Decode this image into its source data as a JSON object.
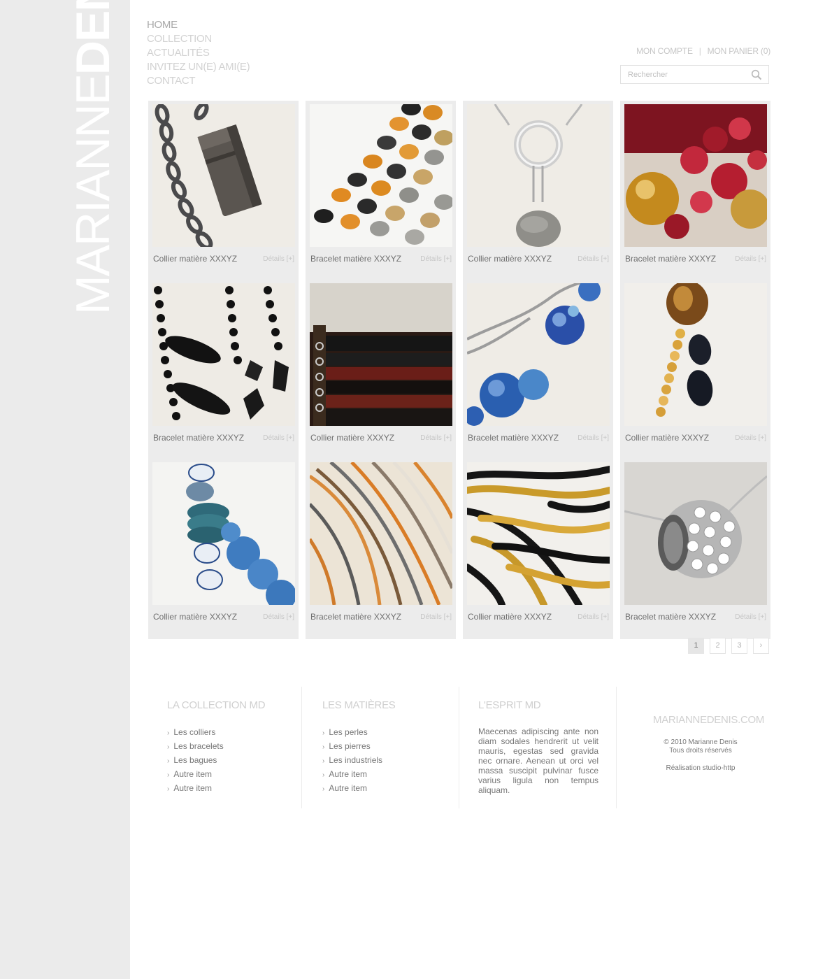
{
  "brand": {
    "part1": "MARIANNE",
    "part2": "DENIS"
  },
  "nav": {
    "items": [
      {
        "label": "HOME",
        "active": true
      },
      {
        "label": "COLLECTION"
      },
      {
        "label": "ACTUALITÉS"
      },
      {
        "label": "INVITEZ UN(E) AMI(E)"
      },
      {
        "label": "CONTACT"
      }
    ]
  },
  "account": {
    "my_account": "MON COMPTE",
    "separator": "|",
    "cart": "MON PANIER (0)"
  },
  "search": {
    "placeholder": "Rechercher",
    "icon": "search-icon"
  },
  "products": [
    {
      "name": "Collier matière XXXYZ",
      "details": "Détails [+]"
    },
    {
      "name": "Bracelet matière XXXYZ",
      "details": "Détails [+]"
    },
    {
      "name": "Collier matière XXXYZ",
      "details": "Détails [+]"
    },
    {
      "name": "Bracelet matière XXXYZ",
      "details": "Détails [+]"
    },
    {
      "name": "Bracelet matière XXXYZ",
      "details": "Détails [+]"
    },
    {
      "name": "Collier matière XXXYZ",
      "details": "Détails [+]"
    },
    {
      "name": "Bracelet matière XXXYZ",
      "details": "Détails [+]"
    },
    {
      "name": "Collier matière XXXYZ",
      "details": "Détails [+]"
    },
    {
      "name": "Collier matière XXXYZ",
      "details": "Détails [+]"
    },
    {
      "name": "Bracelet matière XXXYZ",
      "details": "Détails [+]"
    },
    {
      "name": "Collier matière XXXYZ",
      "details": "Détails [+]"
    },
    {
      "name": "Bracelet matière XXXYZ",
      "details": "Détails [+]"
    }
  ],
  "pagination": {
    "pages": [
      "1",
      "2",
      "3"
    ],
    "current": "1",
    "next": "›"
  },
  "footer": {
    "collection": {
      "title": "LA COLLECTION MD",
      "items": [
        "Les colliers",
        "Les bracelets",
        "Les bagues",
        "Autre item",
        "Autre item"
      ]
    },
    "materials": {
      "title": "LES MATIÈRES",
      "items": [
        "Les perles",
        "Les pierres",
        "Les industriels",
        "Autre item",
        "Autre item"
      ]
    },
    "spirit": {
      "title": "L'ESPRIT MD",
      "text": "Maecenas adipiscing ante non diam sodales hendrerit ut velit mauris, egestas sed gravida nec ornare. Aenean ut orci vel massa suscipit pulvinar fusce varius ligula non tempus aliquam."
    },
    "site": "MARIANNEDENIS.COM",
    "copyright_line1": "© 2010 Marianne Denis",
    "copyright_line2": "Tous droits réservés",
    "credit": "Réalisation studio-http"
  }
}
